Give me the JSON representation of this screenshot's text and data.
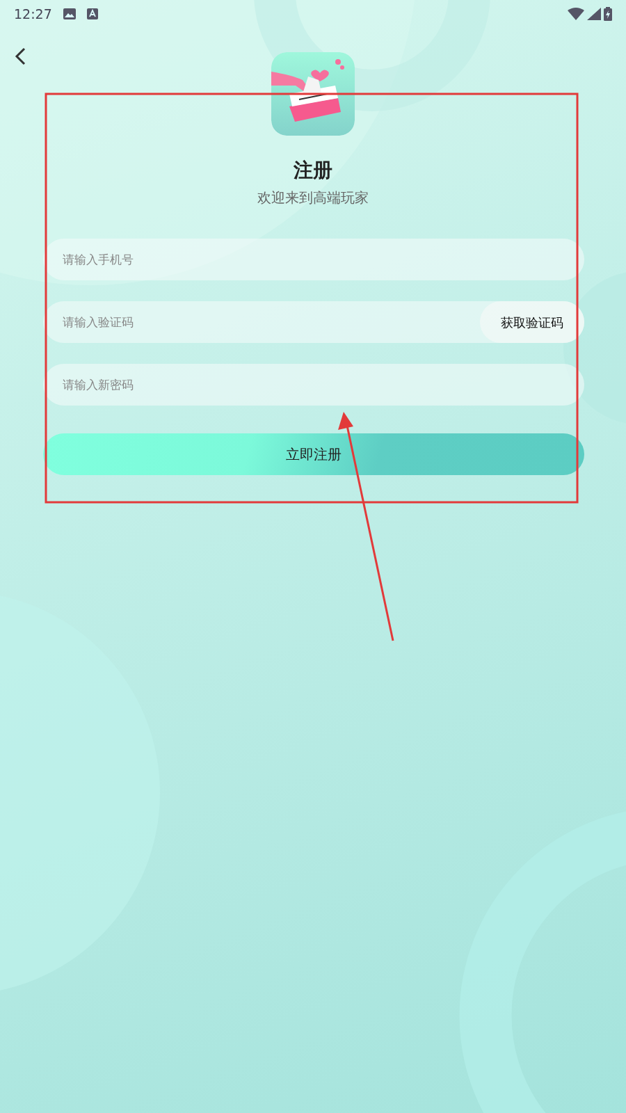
{
  "status_bar": {
    "time": "12:27"
  },
  "header": {
    "title": "注册",
    "subtitle": "欢迎来到高端玩家"
  },
  "fields": [
    {
      "placeholder": "请输入手机号"
    },
    {
      "placeholder": "请输入验证码",
      "action": "获取验证码"
    },
    {
      "placeholder": "请输入新密码"
    }
  ],
  "submit": {
    "label": "立即注册"
  }
}
